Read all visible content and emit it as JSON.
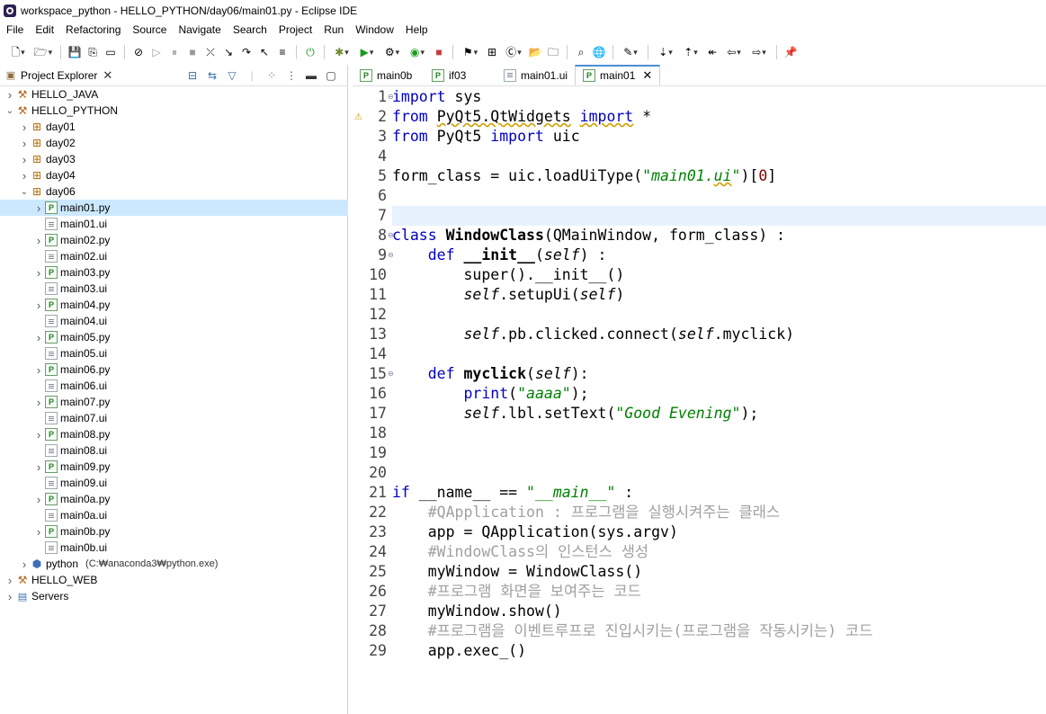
{
  "window": {
    "title": "workspace_python - HELLO_PYTHON/day06/main01.py - Eclipse IDE"
  },
  "menu": [
    "File",
    "Edit",
    "Refactoring",
    "Source",
    "Navigate",
    "Search",
    "Project",
    "Run",
    "Window",
    "Help"
  ],
  "toolbar": {
    "icons": [
      "new-icon",
      "new-wizard-icon",
      "save-icon",
      "save-all-icon",
      "console-icon",
      "skip-breakpoints-icon",
      "resume-icon",
      "suspend-icon",
      "terminate-icon",
      "disconnect-icon",
      "step-into-icon",
      "step-over-icon",
      "step-return-icon",
      "use-step-filters-icon",
      "power-icon",
      "debug-icon",
      "run-icon",
      "run-last-tool-icon",
      "coverage-icon",
      "stop-icon",
      "external-tools-icon",
      "new-java-package-icon",
      "new-class-icon",
      "open-type-icon",
      "open-task-icon",
      "search-icon",
      "globe-icon",
      "refactor-icon",
      "next-annotation-icon",
      "previous-annotation-icon",
      "last-edit-icon",
      "back-icon",
      "forward-icon",
      "pin-editor-icon"
    ]
  },
  "explorer": {
    "tab_label": "Project Explorer",
    "tree": [
      {
        "label": "HELLO_JAVA",
        "level": 0,
        "twisty": "closed",
        "icon": "project-icon"
      },
      {
        "label": "HELLO_PYTHON",
        "level": 0,
        "twisty": "open",
        "icon": "project-icon"
      },
      {
        "label": "day01",
        "level": 1,
        "twisty": "closed",
        "icon": "package-icon"
      },
      {
        "label": "day02",
        "level": 1,
        "twisty": "closed",
        "icon": "package-icon"
      },
      {
        "label": "day03",
        "level": 1,
        "twisty": "closed",
        "icon": "package-icon"
      },
      {
        "label": "day04",
        "level": 1,
        "twisty": "closed",
        "icon": "package-icon"
      },
      {
        "label": "day06",
        "level": 1,
        "twisty": "open",
        "icon": "package-icon"
      },
      {
        "label": "main01.py",
        "level": 2,
        "twisty": "closed",
        "icon": "python-file-icon",
        "selected": true
      },
      {
        "label": "main01.ui",
        "level": 2,
        "twisty": "none",
        "icon": "ui-file-icon"
      },
      {
        "label": "main02.py",
        "level": 2,
        "twisty": "closed",
        "icon": "python-file-icon"
      },
      {
        "label": "main02.ui",
        "level": 2,
        "twisty": "none",
        "icon": "ui-file-icon"
      },
      {
        "label": "main03.py",
        "level": 2,
        "twisty": "closed",
        "icon": "python-file-icon"
      },
      {
        "label": "main03.ui",
        "level": 2,
        "twisty": "none",
        "icon": "ui-file-icon"
      },
      {
        "label": "main04.py",
        "level": 2,
        "twisty": "closed",
        "icon": "python-file-icon"
      },
      {
        "label": "main04.ui",
        "level": 2,
        "twisty": "none",
        "icon": "ui-file-icon"
      },
      {
        "label": "main05.py",
        "level": 2,
        "twisty": "closed",
        "icon": "python-file-icon"
      },
      {
        "label": "main05.ui",
        "level": 2,
        "twisty": "none",
        "icon": "ui-file-icon"
      },
      {
        "label": "main06.py",
        "level": 2,
        "twisty": "closed",
        "icon": "python-file-icon"
      },
      {
        "label": "main06.ui",
        "level": 2,
        "twisty": "none",
        "icon": "ui-file-icon"
      },
      {
        "label": "main07.py",
        "level": 2,
        "twisty": "closed",
        "icon": "python-file-icon"
      },
      {
        "label": "main07.ui",
        "level": 2,
        "twisty": "none",
        "icon": "ui-file-icon"
      },
      {
        "label": "main08.py",
        "level": 2,
        "twisty": "closed",
        "icon": "python-file-icon"
      },
      {
        "label": "main08.ui",
        "level": 2,
        "twisty": "none",
        "icon": "ui-file-icon"
      },
      {
        "label": "main09.py",
        "level": 2,
        "twisty": "closed",
        "icon": "python-file-icon"
      },
      {
        "label": "main09.ui",
        "level": 2,
        "twisty": "none",
        "icon": "ui-file-icon"
      },
      {
        "label": "main0a.py",
        "level": 2,
        "twisty": "closed",
        "icon": "python-file-icon"
      },
      {
        "label": "main0a.ui",
        "level": 2,
        "twisty": "none",
        "icon": "ui-file-icon"
      },
      {
        "label": "main0b.py",
        "level": 2,
        "twisty": "closed",
        "icon": "python-file-icon"
      },
      {
        "label": "main0b.ui",
        "level": 2,
        "twisty": "none",
        "icon": "ui-file-icon"
      },
      {
        "label": "python",
        "level": 1,
        "twisty": "closed",
        "icon": "python-interpreter-icon",
        "sub": "(C:₩anaconda3₩python.exe)"
      },
      {
        "label": "HELLO_WEB",
        "level": 0,
        "twisty": "closed",
        "icon": "project-icon"
      },
      {
        "label": "Servers",
        "level": 0,
        "twisty": "closed",
        "icon": "servers-icon"
      }
    ]
  },
  "editor": {
    "tabs": [
      {
        "label": "main0b",
        "icon": "python-file-icon",
        "active": false
      },
      {
        "label": "if03",
        "icon": "python-file-icon",
        "active": false
      },
      {
        "label": "main01.ui",
        "icon": "ui-file-icon",
        "active": false
      },
      {
        "label": "main01",
        "icon": "python-file-icon",
        "active": true
      }
    ],
    "current_line": 7,
    "lines": [
      {
        "n": "1",
        "fold": true,
        "tokens": [
          [
            "kw",
            "import"
          ],
          [
            "",
            " sys"
          ]
        ]
      },
      {
        "n": "2",
        "warn": true,
        "tokens": [
          [
            "kw",
            "from"
          ],
          [
            "",
            " "
          ],
          [
            "sq",
            "PyQt5.QtWidgets"
          ],
          [
            "",
            " "
          ],
          [
            "kw sq",
            "import"
          ],
          [
            "",
            " *"
          ]
        ]
      },
      {
        "n": "3",
        "tokens": [
          [
            "kw",
            "from"
          ],
          [
            "",
            " PyQt5 "
          ],
          [
            "kw",
            "import"
          ],
          [
            "",
            " uic"
          ]
        ]
      },
      {
        "n": "4",
        "tokens": []
      },
      {
        "n": "5",
        "tokens": [
          [
            "",
            "form_class = uic.loadUiType("
          ],
          [
            "str",
            "\"main01."
          ],
          [
            "str sq",
            "ui"
          ],
          [
            "str",
            "\""
          ],
          [
            "",
            ")["
          ],
          [
            "num",
            "0"
          ],
          [
            "",
            "]"
          ]
        ]
      },
      {
        "n": "6",
        "tokens": []
      },
      {
        "n": "7",
        "tokens": []
      },
      {
        "n": "8",
        "fold": true,
        "tokens": [
          [
            "kw",
            "class"
          ],
          [
            "",
            " "
          ],
          [
            "bold",
            "WindowClass"
          ],
          [
            "",
            "(QMainWindow, form_class) :"
          ]
        ]
      },
      {
        "n": "9",
        "fold": true,
        "tokens": [
          [
            "",
            "    "
          ],
          [
            "kw",
            "def"
          ],
          [
            "",
            " "
          ],
          [
            "bold",
            "__init__"
          ],
          [
            "",
            "("
          ],
          [
            "self",
            "self"
          ],
          [
            "",
            ") :"
          ]
        ]
      },
      {
        "n": "10",
        "tokens": [
          [
            "",
            "        super().__init__()"
          ]
        ]
      },
      {
        "n": "11",
        "tokens": [
          [
            "",
            "        "
          ],
          [
            "self",
            "self"
          ],
          [
            "",
            ".setupUi("
          ],
          [
            "self",
            "self"
          ],
          [
            "",
            ")"
          ]
        ]
      },
      {
        "n": "12",
        "tokens": []
      },
      {
        "n": "13",
        "tokens": [
          [
            "",
            "        "
          ],
          [
            "self",
            "self"
          ],
          [
            "",
            ".pb.clicked.connect("
          ],
          [
            "self",
            "self"
          ],
          [
            "",
            ".myclick)"
          ]
        ]
      },
      {
        "n": "14",
        "tokens": []
      },
      {
        "n": "15",
        "fold": true,
        "tokens": [
          [
            "",
            "    "
          ],
          [
            "kw",
            "def"
          ],
          [
            "",
            " "
          ],
          [
            "bold",
            "myclick"
          ],
          [
            "",
            "("
          ],
          [
            "self",
            "self"
          ],
          [
            "",
            "):"
          ]
        ]
      },
      {
        "n": "16",
        "tokens": [
          [
            "",
            "        "
          ],
          [
            "kw",
            "print"
          ],
          [
            "",
            "("
          ],
          [
            "str",
            "\"aaaa\""
          ],
          [
            "",
            ");"
          ]
        ]
      },
      {
        "n": "17",
        "tokens": [
          [
            "",
            "        "
          ],
          [
            "self",
            "self"
          ],
          [
            "",
            ".lbl.setText("
          ],
          [
            "str",
            "\"Good Evening\""
          ],
          [
            "",
            ");"
          ]
        ]
      },
      {
        "n": "18",
        "tokens": []
      },
      {
        "n": "19",
        "tokens": []
      },
      {
        "n": "20",
        "tokens": []
      },
      {
        "n": "21",
        "tokens": [
          [
            "kw",
            "if"
          ],
          [
            "",
            " __name__ == "
          ],
          [
            "str",
            "\"__main__\""
          ],
          [
            "",
            " :"
          ]
        ]
      },
      {
        "n": "22",
        "tokens": [
          [
            "",
            "    "
          ],
          [
            "com",
            "#QApplication : 프로그램을 실행시켜주는 클래스"
          ]
        ]
      },
      {
        "n": "23",
        "tokens": [
          [
            "",
            "    app = QApplication(sys.argv)"
          ]
        ]
      },
      {
        "n": "24",
        "tokens": [
          [
            "",
            "    "
          ],
          [
            "com",
            "#WindowClass의 인스턴스 생성"
          ]
        ]
      },
      {
        "n": "25",
        "tokens": [
          [
            "",
            "    myWindow = WindowClass()"
          ]
        ]
      },
      {
        "n": "26",
        "tokens": [
          [
            "",
            "    "
          ],
          [
            "com",
            "#프로그램 화면을 보여주는 코드"
          ]
        ]
      },
      {
        "n": "27",
        "tokens": [
          [
            "",
            "    myWindow.show()"
          ]
        ]
      },
      {
        "n": "28",
        "tokens": [
          [
            "",
            "    "
          ],
          [
            "com",
            "#프로그램을 이벤트루프로 진입시키는(프로그램을 작동시키는) 코드"
          ]
        ]
      },
      {
        "n": "29",
        "tokens": [
          [
            "",
            "    app.exec_()"
          ]
        ]
      }
    ]
  }
}
